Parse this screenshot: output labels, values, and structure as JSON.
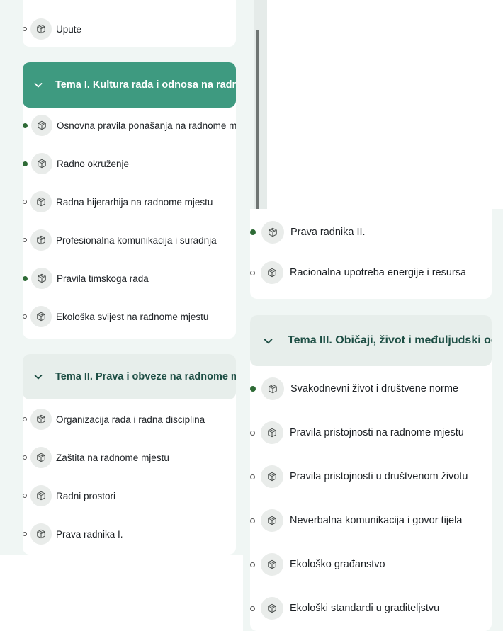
{
  "left": {
    "top_item": {
      "label": "Upute",
      "done": false
    },
    "section1": {
      "title": "Tema I. Kultura rada i odnosa na radnome mjestu",
      "items": [
        {
          "label": "Osnovna pravila ponašanja na radnome mjestu",
          "done": true
        },
        {
          "label": "Radno okruženje",
          "done": true
        },
        {
          "label": "Radna hijerarhija na radnome mjestu",
          "done": false
        },
        {
          "label": "Profesionalna komunikacija i suradnja",
          "done": false
        },
        {
          "label": "Pravila timskoga rada",
          "done": true
        },
        {
          "label": "Ekološka svijest na radnome mjestu",
          "done": false
        }
      ]
    },
    "section2": {
      "title": "Tema II. Prava i obveze na radnome mjestu",
      "items": [
        {
          "label": "Organizacija rada i radna disciplina",
          "done": false
        },
        {
          "label": "Zaštita na radnome mjestu",
          "done": false
        },
        {
          "label": "Radni prostori",
          "done": false
        },
        {
          "label": "Prava radnika I.",
          "done": false
        }
      ]
    }
  },
  "right": {
    "top_items": [
      {
        "label": "Prava radnika II.",
        "done": true
      },
      {
        "label": "Racionalna upotreba energije i resursa",
        "done": false
      }
    ],
    "section3": {
      "title": "Tema III. Običaji, život i međuljudski odnosi",
      "items": [
        {
          "label": "Svakodnevni život i društvene norme",
          "done": true
        },
        {
          "label": "Pravila pristojnosti na radnome mjestu",
          "done": false
        },
        {
          "label": "Pravila pristojnosti u društvenom životu",
          "done": false
        },
        {
          "label": "Neverbalna komunikacija i govor tijela",
          "done": false
        },
        {
          "label": "Ekološko građanstvo",
          "done": false
        },
        {
          "label": "Ekološki standardi u graditeljstvu",
          "done": false
        }
      ]
    }
  },
  "colors": {
    "accent": "#3e9a80",
    "done_dot": "#2e6b36",
    "panel_bg": "#f0f6f4"
  },
  "icons": {
    "activity": "package-icon",
    "collapse": "chevron-down-icon"
  }
}
